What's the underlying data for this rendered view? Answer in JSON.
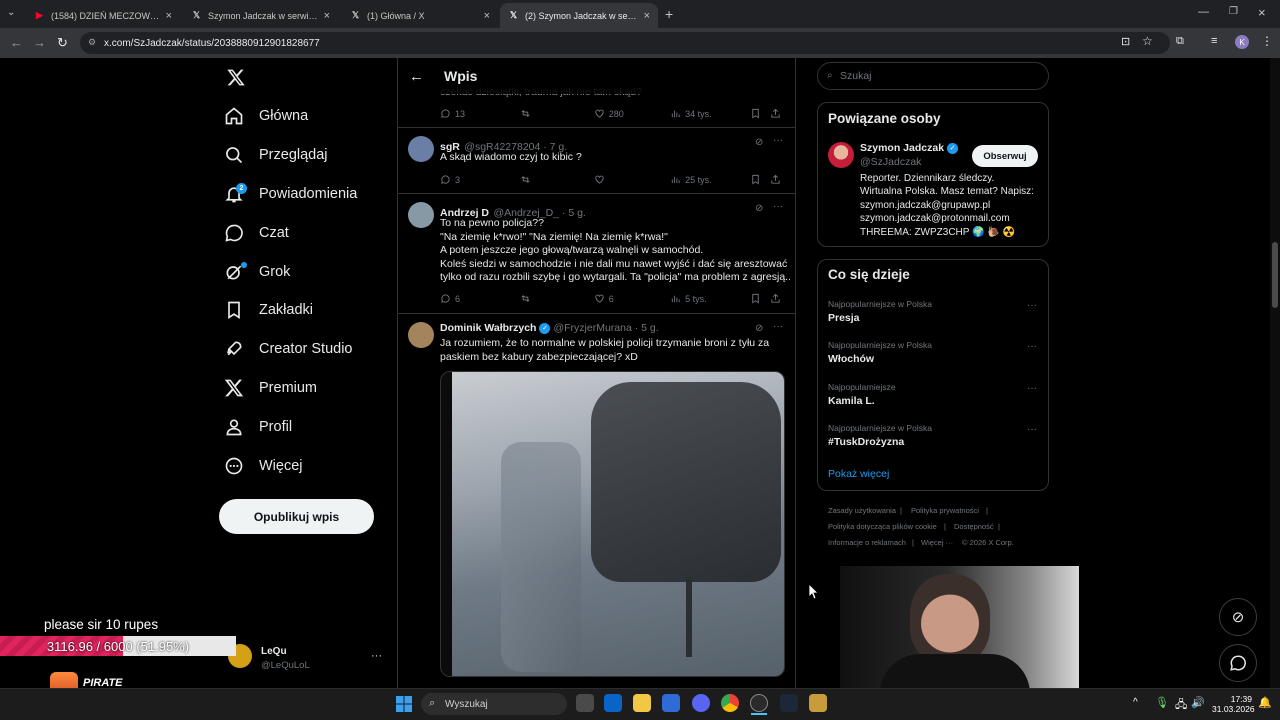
{
  "browser": {
    "tabs": [
      {
        "label": "(1584) DZIEŃ MECZOWY. Meld…",
        "icon": "youtube-icon",
        "active": false
      },
      {
        "label": "Szymon Jadczak w serwisie X: …",
        "icon": "x-logo-icon",
        "active": false
      },
      {
        "label": "(1) Główna / X",
        "icon": "x-logo-icon",
        "active": false
      },
      {
        "label": "(2) Szymon Jadczak w serwisie …",
        "icon": "x-logo-icon",
        "active": true
      }
    ],
    "url": "x.com/SzJadczak/status/2038880912901828677"
  },
  "sidebar": {
    "items": [
      {
        "label": "Główna",
        "icon": "home-icon"
      },
      {
        "label": "Przeglądaj",
        "icon": "search-icon"
      },
      {
        "label": "Powiadomienia",
        "icon": "bell-icon",
        "badge": "2"
      },
      {
        "label": "Czat",
        "icon": "chat-icon"
      },
      {
        "label": "Grok",
        "icon": "grok-icon"
      },
      {
        "label": "Zakładki",
        "icon": "bookmark-icon"
      },
      {
        "label": "Creator Studio",
        "icon": "rocket-icon"
      },
      {
        "label": "Premium",
        "icon": "x-logo-icon"
      },
      {
        "label": "Profil",
        "icon": "person-icon"
      },
      {
        "label": "Więcej",
        "icon": "more-circle-icon"
      }
    ],
    "post_button": "Opublikuj wpis",
    "account": {
      "name": "LeQu",
      "handle": "@LeQuLoL"
    }
  },
  "main": {
    "title": "Wpis",
    "partial_text": "czekać dziesiątki, trauma jak nie tam skąd?",
    "partial_stats": {
      "replies": "13",
      "likes": "280",
      "views": "34 tys."
    },
    "tweets": [
      {
        "name": "sgR",
        "handle": "@sgR42278204 · 7 g.",
        "lines": [
          "A skąd wiadomo czyj to kibic ?"
        ],
        "replies": "3",
        "retweets": "",
        "likes": "",
        "views": "25 tys."
      },
      {
        "name": "Andrzej D",
        "handle": "@Andrzej_D_ · 5 g.",
        "lines": [
          "To na pewno policja??",
          "\"Na ziemię k*rwo!\" \"Na ziemię! Na ziemię k*rwa!\"",
          "A potem jeszcze jego głową/twarzą walnęli w samochód.",
          "Koleś siedzi w samochodzie i nie dali mu nawet wyjść i dać się aresztować",
          "tylko od razu rozbili szybę i go wytargali. Ta \"policja\" ma problem z agresją..."
        ],
        "replies": "6",
        "retweets": "",
        "likes": "6",
        "views": "5 tys."
      },
      {
        "name": "Dominik Wałbrzych",
        "handle": "@FryzjerMurana · 5 g.",
        "lines": [
          "Ja rozumiem, że to normalne w polskiej policji trzymanie broni z tyłu za",
          "paskiem bez kabury zabezpieczającej? xD"
        ]
      }
    ]
  },
  "right": {
    "search_placeholder": "Szukaj",
    "related": {
      "title": "Powiązane osoby",
      "name": "Szymon Jadczak",
      "handle": "@SzJadczak",
      "follow": "Obserwuj",
      "bio": [
        "Reporter. Dziennikarz śledczy.",
        "Wirtualna Polska. Masz temat? Napisz:",
        "szymon.jadczak@grupawp.pl",
        "szymon.jadczak@protonmail.com",
        "THREEMA: ZWPZ3CHP 🌍 🐌 ☢️"
      ]
    },
    "trends": {
      "title": "Co się dzieje",
      "items": [
        {
          "context": "Najpopularniejsze w Polska",
          "name": "Presja"
        },
        {
          "context": "Najpopularniejsze w Polska",
          "name": "Włochów"
        },
        {
          "context": "Najpopularniejsze",
          "name": "Kamila L."
        },
        {
          "context": "Najpopularniejsze w Polska",
          "name": "#TuskDrożyzna"
        }
      ],
      "more": "Pokaż więcej"
    },
    "footer": [
      "Zasady użytkowania",
      "Polityka prywatności",
      "Polityka dotycząca plików cookie",
      "Dostępność",
      "Informacje o reklamach",
      "Więcej ···",
      "© 2026 X Corp."
    ]
  },
  "overlay": {
    "donation_text": "please sir 10 rupes",
    "goal": "3116.96 / 6000 (51.95%)",
    "goal_fraction": 0.5195,
    "sponsor": "PIRATE SWAP"
  },
  "taskbar": {
    "search": "Wyszukaj",
    "time": "17:39",
    "date": "31.03.2026"
  },
  "colors": {
    "accent": "#1d9bf0",
    "bg": "#000000",
    "border": "#2f3336",
    "muted": "#71767b",
    "goal_bar": "#e0245e"
  }
}
